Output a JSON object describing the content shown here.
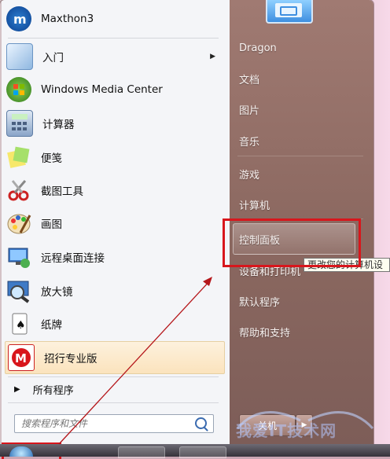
{
  "start_menu": {
    "programs": [
      {
        "label": "Maxthon3",
        "icon": "maxthon-icon"
      },
      {
        "label": "入门",
        "icon": "getting-started-icon",
        "has_submenu": true
      },
      {
        "label": "Windows Media Center",
        "icon": "windows-media-center-icon"
      },
      {
        "label": "计算器",
        "icon": "calculator-icon"
      },
      {
        "label": "便笺",
        "icon": "sticky-notes-icon"
      },
      {
        "label": "截图工具",
        "icon": "snipping-tool-icon"
      },
      {
        "label": "画图",
        "icon": "paint-icon"
      },
      {
        "label": "远程桌面连接",
        "icon": "remote-desktop-icon"
      },
      {
        "label": "放大镜",
        "icon": "magnifier-icon"
      },
      {
        "label": "纸牌",
        "icon": "solitaire-icon"
      },
      {
        "label": "招行专业版",
        "icon": "cmb-icon"
      }
    ],
    "all_programs": "所有程序",
    "search_placeholder": "搜索程序和文件",
    "places": [
      {
        "label": "Dragon"
      },
      {
        "label": "文档"
      },
      {
        "label": "图片"
      },
      {
        "label": "音乐"
      },
      {
        "label": "游戏"
      },
      {
        "label": "计算机"
      },
      {
        "label": "控制面板"
      },
      {
        "label": "设备和打印机"
      },
      {
        "label": "默认程序"
      },
      {
        "label": "帮助和支持"
      }
    ],
    "tooltip": "更改您的计算机设",
    "shutdown_label": "关机"
  },
  "watermark": "我爱IT技术网",
  "colors": {
    "highlight": "#d8161c",
    "right_pane": "#8c6961"
  }
}
